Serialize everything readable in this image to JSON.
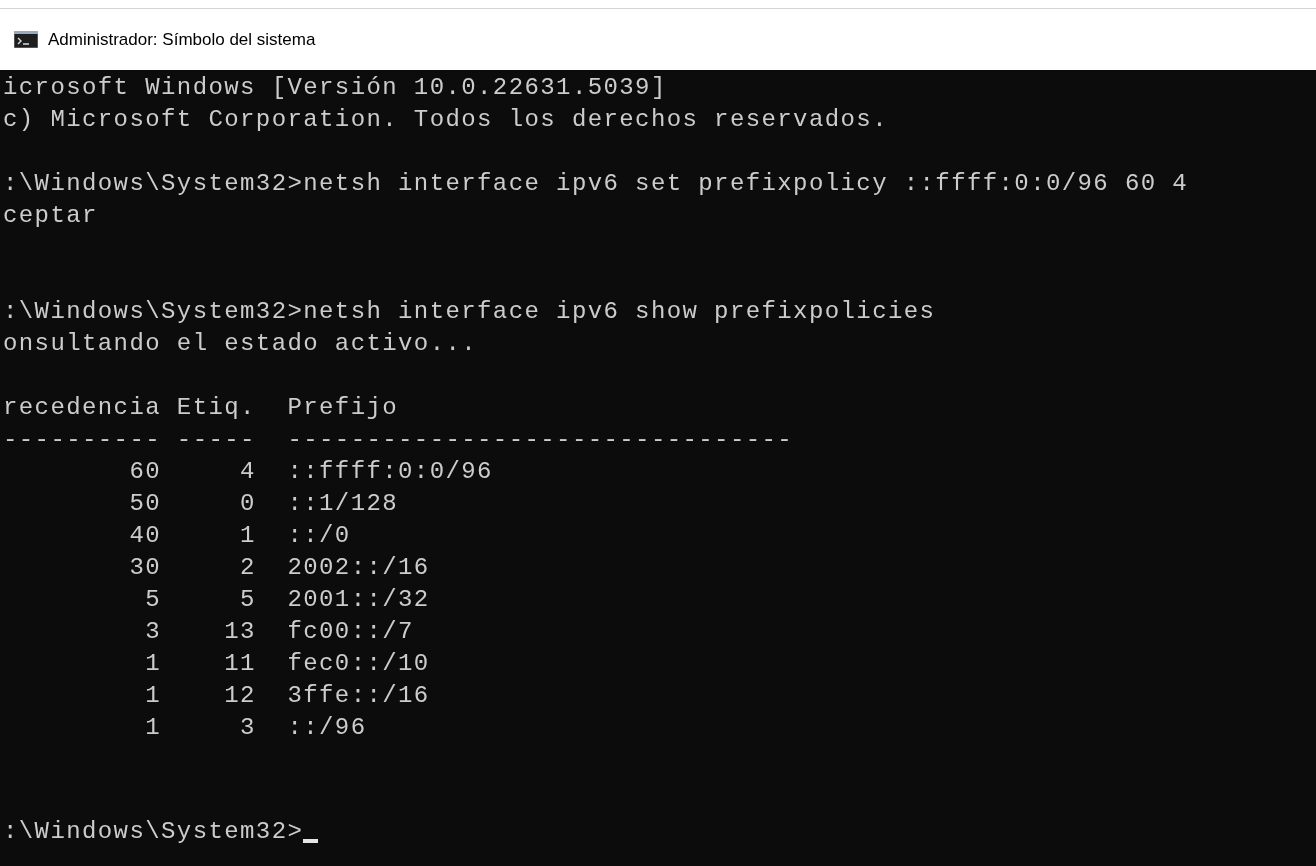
{
  "window": {
    "title": "Administrador: Símbolo del sistema"
  },
  "console": {
    "lines": [
      {
        "kind": "text",
        "text": "icrosoft Windows [Versión 10.0.22631.5039]"
      },
      {
        "kind": "text",
        "text": "c) Microsoft Corporation. Todos los derechos reservados."
      },
      {
        "kind": "blank"
      },
      {
        "kind": "text",
        "text": ":\\Windows\\System32>netsh interface ipv6 set prefixpolicy ::ffff:0:0/96 60 4"
      },
      {
        "kind": "text",
        "text": "ceptar"
      },
      {
        "kind": "blank"
      },
      {
        "kind": "blank"
      },
      {
        "kind": "text",
        "text": ":\\Windows\\System32>netsh interface ipv6 show prefixpolicies"
      },
      {
        "kind": "text",
        "text": "onsultando el estado activo..."
      },
      {
        "kind": "blank"
      },
      {
        "kind": "text",
        "text": "recedencia Etiq.  Prefijo"
      },
      {
        "kind": "text",
        "text": "---------- -----  --------------------------------"
      },
      {
        "kind": "text",
        "text": "        60     4  ::ffff:0:0/96"
      },
      {
        "kind": "text",
        "text": "        50     0  ::1/128"
      },
      {
        "kind": "text",
        "text": "        40     1  ::/0"
      },
      {
        "kind": "text",
        "text": "        30     2  2002::/16"
      },
      {
        "kind": "text",
        "text": "         5     5  2001::/32"
      },
      {
        "kind": "text",
        "text": "         3    13  fc00::/7"
      },
      {
        "kind": "text",
        "text": "         1    11  fec0::/10"
      },
      {
        "kind": "text",
        "text": "         1    12  3ffe::/16"
      },
      {
        "kind": "text",
        "text": "         1     3  ::/96"
      },
      {
        "kind": "blank"
      },
      {
        "kind": "blank"
      },
      {
        "kind": "prompt",
        "text": ":\\Windows\\System32>",
        "cursor": true
      }
    ]
  }
}
